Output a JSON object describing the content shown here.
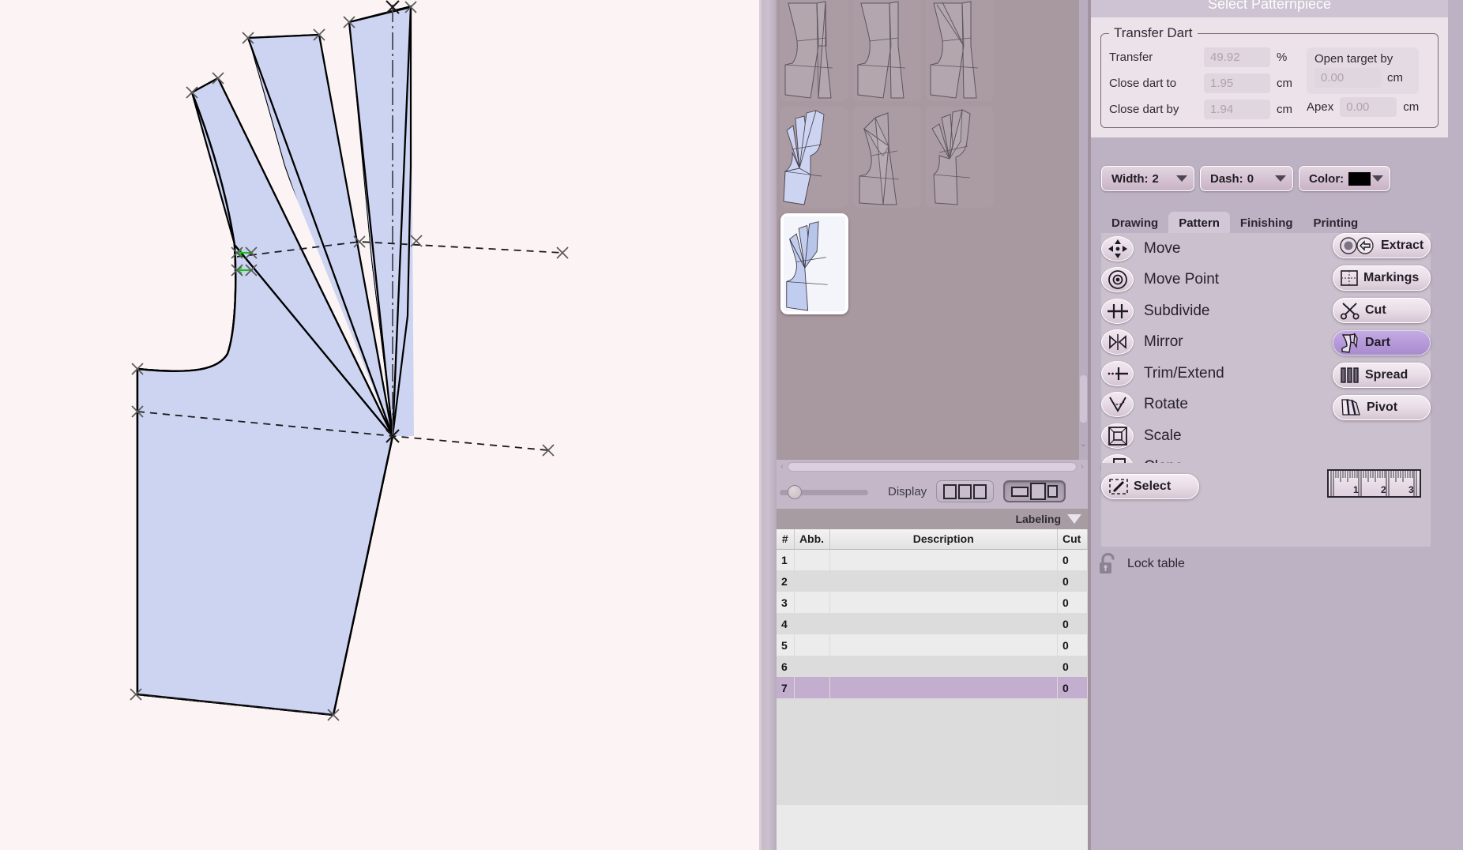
{
  "app": {
    "accent_purple": "#b89bdb",
    "panel_bg": "#bdb1c4",
    "canvas_bg": "#fbf3f4",
    "pattern_fill": "#ccd4f2",
    "pattern_stroke": "#000000",
    "marker_green": "#22bb22",
    "selection_purple": "#c4aed0"
  },
  "dialog": {
    "title": "Select Patternpiece",
    "group_title": "Transfer Dart",
    "fields": [
      {
        "label": "Transfer",
        "value": "49.92",
        "unit": "%"
      },
      {
        "label": "Close dart to",
        "value": "1.95",
        "unit": "cm"
      },
      {
        "label": "Close dart by",
        "value": "1.94",
        "unit": "cm"
      }
    ],
    "open_target": {
      "label": "Open target by",
      "value": "0.00",
      "unit": "cm"
    },
    "apex": {
      "label": "Apex",
      "value": "0.00",
      "unit": "cm"
    }
  },
  "style_row": {
    "width": {
      "label": "Width:",
      "value": "2"
    },
    "dash": {
      "label": "Dash:",
      "value": "0"
    },
    "color": {
      "label": "Color:",
      "value": "#000000"
    }
  },
  "tabs": [
    {
      "label": "Drawing",
      "active": false
    },
    {
      "label": "Pattern",
      "active": true
    },
    {
      "label": "Finishing",
      "active": false
    },
    {
      "label": "Printing",
      "active": false
    }
  ],
  "tools_left": [
    {
      "label": "Move",
      "icon": "move-arrows-icon"
    },
    {
      "label": "Move Point",
      "icon": "target-point-icon"
    },
    {
      "label": "Subdivide",
      "icon": "subdivide-icon"
    },
    {
      "label": "Mirror",
      "icon": "mirror-icon"
    },
    {
      "label": "Trim/Extend",
      "icon": "trim-extend-icon"
    },
    {
      "label": "Rotate",
      "icon": "rotate-angle-icon"
    },
    {
      "label": "Scale",
      "icon": "scale-square-icon"
    },
    {
      "label": "Clone",
      "icon": "clone-stack-icon"
    }
  ],
  "tools_right": [
    {
      "label": "Extract",
      "icon": "extract-arrow-icon",
      "active": false
    },
    {
      "label": "Markings",
      "icon": "markings-grid-icon",
      "active": false
    },
    {
      "label": "Cut",
      "icon": "scissors-icon",
      "active": false
    },
    {
      "label": "Dart",
      "icon": "dart-piece-icon",
      "active": true
    },
    {
      "label": "Spread",
      "icon": "spread-bars-icon",
      "active": false
    },
    {
      "label": "Pivot",
      "icon": "pivot-fan-icon",
      "active": false
    }
  ],
  "select_button": {
    "label": "Select",
    "icon": "select-marquee-icon"
  },
  "ruler": {
    "ticks": [
      "1",
      "2",
      "3"
    ]
  },
  "lock_table": {
    "label": "Lock table",
    "icon": "unlocked-padlock-icon"
  },
  "display_bar": {
    "label": "Display",
    "zoom_value": 10,
    "mode_three_equal": "display-mode-equal",
    "mode_mixed": "display-mode-mixed",
    "active_mode": "display-mode-mixed"
  },
  "labeling": {
    "label": "Labeling",
    "caret": "caret-down-icon"
  },
  "table": {
    "columns": [
      "#",
      "Abb.",
      "Description",
      "Cut"
    ],
    "rows": [
      {
        "num": "1",
        "abb": "",
        "desc": "",
        "cut": "0",
        "selected": false
      },
      {
        "num": "2",
        "abb": "",
        "desc": "",
        "cut": "0",
        "selected": false
      },
      {
        "num": "3",
        "abb": "",
        "desc": "",
        "cut": "0",
        "selected": false
      },
      {
        "num": "4",
        "abb": "",
        "desc": "",
        "cut": "0",
        "selected": false
      },
      {
        "num": "5",
        "abb": "",
        "desc": "",
        "cut": "0",
        "selected": false
      },
      {
        "num": "6",
        "abb": "",
        "desc": "",
        "cut": "0",
        "selected": false
      },
      {
        "num": "7",
        "abb": "",
        "desc": "",
        "cut": "0",
        "selected": true
      },
      {
        "num": "",
        "abb": "",
        "desc": "",
        "cut": "",
        "selected": false
      },
      {
        "num": "",
        "abb": "",
        "desc": "",
        "cut": "",
        "selected": false
      },
      {
        "num": "",
        "abb": "",
        "desc": "",
        "cut": "",
        "selected": false
      },
      {
        "num": "",
        "abb": "",
        "desc": "",
        "cut": "",
        "selected": false
      },
      {
        "num": "",
        "abb": "",
        "desc": "",
        "cut": "",
        "selected": false
      }
    ]
  },
  "thumbnails": {
    "count": 7,
    "selected_index": 6,
    "cells": [
      {
        "variant": "bodice-plain-1",
        "highlighted": false
      },
      {
        "variant": "bodice-plain-2",
        "highlighted": false
      },
      {
        "variant": "bodice-dart-3",
        "highlighted": false
      },
      {
        "variant": "bodice-spread-4",
        "highlighted": true
      },
      {
        "variant": "bodice-plain-5",
        "highlighted": false
      },
      {
        "variant": "bodice-dart-6",
        "highlighted": false
      },
      {
        "variant": "bodice-spread-7",
        "highlighted": true
      }
    ]
  },
  "canvas": {
    "description": "Bodice front patternpiece with three spread dart wedges fanning from an apex point, dashed construction lines and cross point markers",
    "notes": [
      "dash-dot center line",
      "green direction markers near bust point"
    ]
  }
}
